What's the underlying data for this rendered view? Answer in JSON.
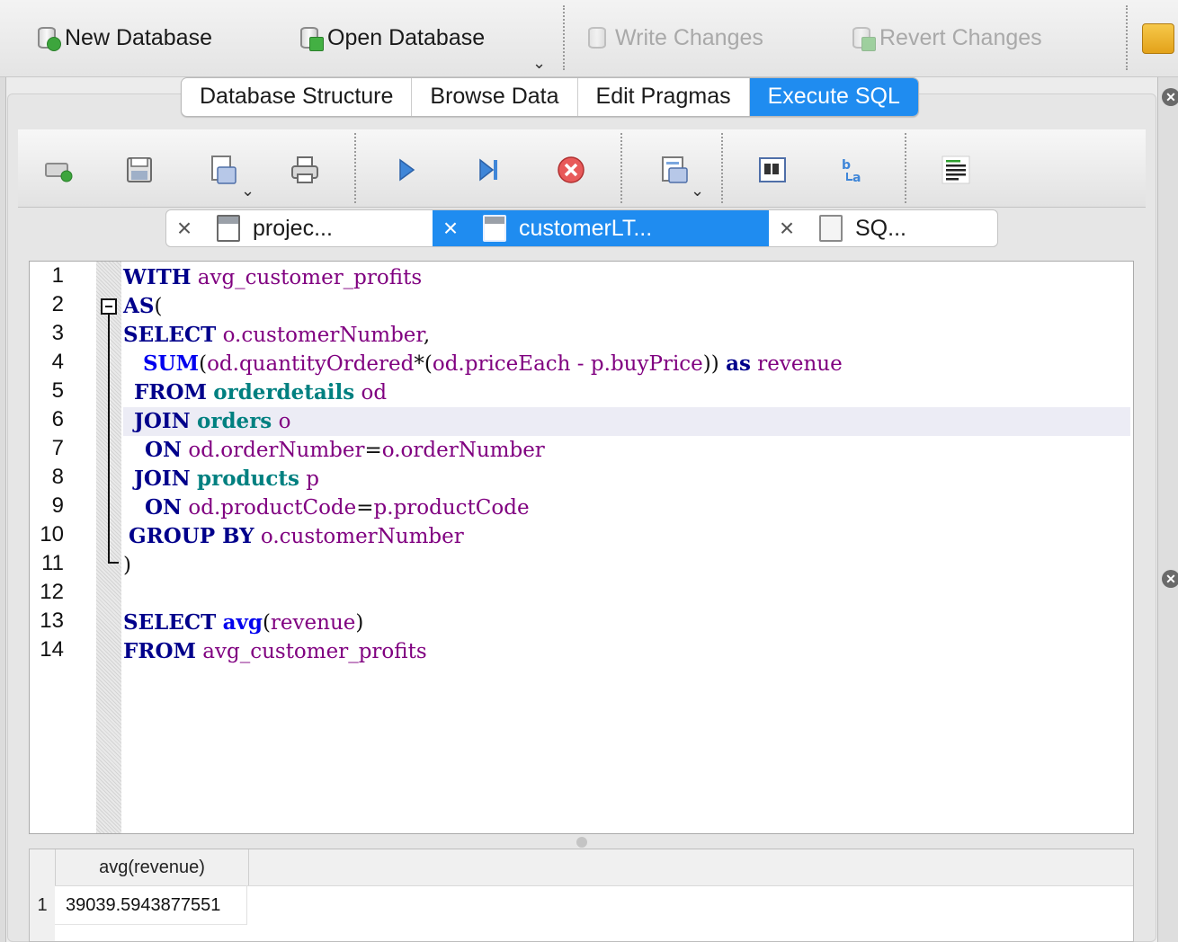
{
  "toolbar": {
    "new_db": "New Database",
    "open_db": "Open Database",
    "write": "Write Changes",
    "revert": "Revert Changes"
  },
  "main_tabs": [
    "Database Structure",
    "Browse Data",
    "Edit Pragmas",
    "Execute SQL"
  ],
  "active_main_tab": "Execute SQL",
  "sql_tabs": [
    "projec...",
    "customerLT...",
    "SQ..."
  ],
  "active_sql_tab": "customerLT...",
  "line_numbers": [
    "1",
    "2",
    "3",
    "4",
    "5",
    "6",
    "7",
    "8",
    "9",
    "10",
    "11",
    "12",
    "13",
    "14"
  ],
  "code": {
    "l1": {
      "kw": "WITH",
      "id": "avg_customer_profits"
    },
    "l2": {
      "kw": "AS",
      "p": "("
    },
    "l3": {
      "kw": "SELECT",
      "id": "o.customerNumber",
      "p": ","
    },
    "l4": {
      "fn": "SUM",
      "p1": "(",
      "id1": "od.quantityOrdered",
      "p2": "*(",
      "id2": "od.priceEach",
      "p3": " - ",
      "id3": "p.buyPrice",
      "p4": "))",
      "kw": "as",
      "id4": "revenue"
    },
    "l5": {
      "kw": "FROM",
      "tbl": "orderdetails",
      "id": "od"
    },
    "l6": {
      "kw": "JOIN",
      "tbl": "orders",
      "id": "o"
    },
    "l7": {
      "kw": "ON",
      "id1": "od.orderNumber",
      "p": "=",
      "id2": "o.orderNumber"
    },
    "l8": {
      "kw": "JOIN",
      "tbl": "products",
      "id": "p"
    },
    "l9": {
      "kw": "ON",
      "id1": "od.productCode",
      "p": "=",
      "id2": "p.productCode"
    },
    "l10": {
      "kw": "GROUP BY",
      "id": "o.customerNumber"
    },
    "l11": {
      "p": ")"
    },
    "l13": {
      "kw": "SELECT",
      "fn": "avg",
      "p1": "(",
      "id": "revenue",
      "p2": ")"
    },
    "l14": {
      "kw": "FROM",
      "id": "avg_customer_profits"
    }
  },
  "results": {
    "column": "avg(revenue)",
    "row_num": "1",
    "value": "39039.5943877551"
  },
  "colors": {
    "accent": "#1f8cf0",
    "keyword": "#00008b",
    "function": "#0000ee",
    "table": "#008080",
    "identifier": "#800080"
  }
}
